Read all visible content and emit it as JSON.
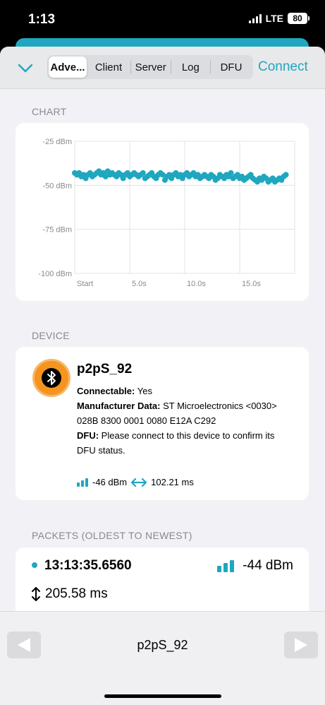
{
  "status_bar": {
    "time": "1:13",
    "network": "LTE",
    "battery": "80"
  },
  "navbar": {
    "tabs": [
      {
        "label": "Adve...",
        "active": true
      },
      {
        "label": "Client",
        "active": false
      },
      {
        "label": "Server",
        "active": false
      },
      {
        "label": "Log",
        "active": false
      },
      {
        "label": "DFU",
        "active": false
      }
    ],
    "connect_label": "Connect"
  },
  "chart_section": {
    "header": "CHART"
  },
  "chart_data": {
    "type": "scatter",
    "y_tick_labels": [
      "-25 dBm",
      "-50 dBm",
      "-75 dBm",
      "-100 dBm"
    ],
    "x_tick_labels": [
      "Start",
      "5.0s",
      "10.0s",
      "15.0s"
    ],
    "ylim": [
      -100,
      -25
    ],
    "xlim": [
      0,
      20
    ],
    "grid": true,
    "color": "#1fa7bf",
    "x": [
      0.0,
      0.2,
      0.4,
      0.6,
      0.8,
      1.0,
      1.2,
      1.4,
      1.6,
      1.8,
      2.0,
      2.2,
      2.4,
      2.6,
      2.8,
      3.0,
      3.2,
      3.4,
      3.6,
      3.8,
      4.0,
      4.2,
      4.4,
      4.6,
      4.8,
      5.0,
      5.2,
      5.4,
      5.6,
      5.8,
      6.0,
      6.2,
      6.4,
      6.6,
      6.8,
      7.0,
      7.2,
      7.4,
      7.6,
      7.8,
      8.0,
      8.2,
      8.4,
      8.6,
      8.8,
      9.0,
      9.2,
      9.4,
      9.6,
      9.8,
      10.0,
      10.2,
      10.4,
      10.6,
      10.8,
      11.0,
      11.2,
      11.4,
      11.6,
      11.8,
      12.0,
      12.2,
      12.4,
      12.6,
      12.8,
      13.0,
      13.2,
      13.4,
      13.6,
      13.8,
      14.0,
      14.2,
      14.4,
      14.6,
      14.8,
      15.0,
      15.2,
      15.4,
      15.6,
      15.8,
      16.0,
      16.2,
      16.4,
      16.6,
      16.8,
      17.0,
      17.2,
      17.4,
      17.6,
      17.8,
      18.0,
      18.2,
      18.4,
      18.6,
      18.8,
      19.0,
      19.2
    ],
    "y": [
      -43,
      -44,
      -43,
      -45,
      -44,
      -46,
      -44,
      -43,
      -45,
      -44,
      -43,
      -42,
      -44,
      -43,
      -45,
      -42,
      -44,
      -43,
      -44,
      -45,
      -43,
      -44,
      -46,
      -44,
      -43,
      -45,
      -44,
      -43,
      -44,
      -45,
      -44,
      -43,
      -46,
      -45,
      -44,
      -43,
      -45,
      -46,
      -44,
      -43,
      -44,
      -47,
      -45,
      -44,
      -46,
      -44,
      -43,
      -45,
      -44,
      -46,
      -44,
      -43,
      -45,
      -44,
      -43,
      -45,
      -44,
      -46,
      -45,
      -44,
      -45,
      -46,
      -44,
      -45,
      -47,
      -46,
      -44,
      -45,
      -46,
      -44,
      -45,
      -43,
      -46,
      -45,
      -44,
      -46,
      -45,
      -47,
      -46,
      -45,
      -44,
      -46,
      -47,
      -48,
      -46,
      -47,
      -45,
      -46,
      -48,
      -47,
      -46,
      -48,
      -47,
      -46,
      -47,
      -45,
      -44
    ]
  },
  "device_section": {
    "header": "DEVICE",
    "name": "p2pS_92",
    "connectable_label": "Connectable:",
    "connectable_value": "Yes",
    "mfr_label": "Manufacturer Data:",
    "mfr_value": "ST Microelectronics <0030> 028B 8300 0001 0080 E12A C292",
    "dfu_label": "DFU:",
    "dfu_value": "Please connect to this device to confirm its DFU status.",
    "rssi": "-46 dBm",
    "interval": "102.21 ms",
    "icon": "bluetooth-icon",
    "icon_color": "#f5941f"
  },
  "packets_section": {
    "header": "PACKETS (OLDEST TO NEWEST)",
    "packets": [
      {
        "time": "13:13:35.6560",
        "rssi": "-44 dBm",
        "interval": "205.58 ms"
      }
    ]
  },
  "bottom_bar": {
    "title": "p2pS_92"
  },
  "colors": {
    "accent": "#1fa7bf",
    "background": "#f2f2f6"
  }
}
